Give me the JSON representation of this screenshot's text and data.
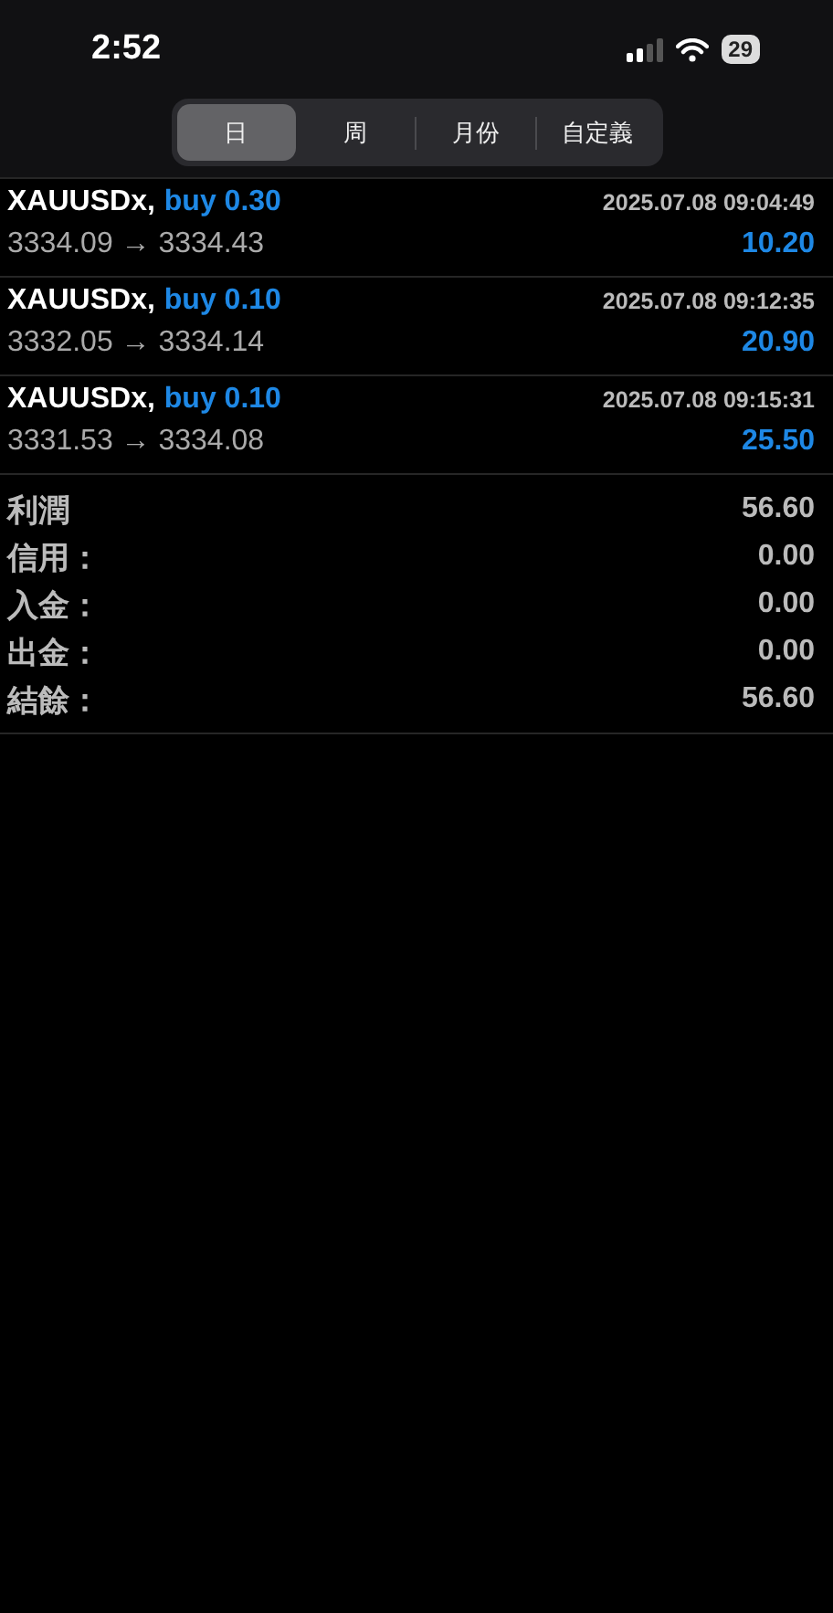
{
  "status_bar": {
    "time": "2:52",
    "battery": "29"
  },
  "tabs": [
    {
      "label": "日",
      "selected": true
    },
    {
      "label": "周",
      "selected": false
    },
    {
      "label": "月份",
      "selected": false
    },
    {
      "label": "自定義",
      "selected": false
    }
  ],
  "trades": [
    {
      "symbol": "XAUUSDx,",
      "side": "buy 0.30",
      "time": "2025.07.08 09:04:49",
      "prices": "3334.09 → 3334.43",
      "profit": "10.20"
    },
    {
      "symbol": "XAUUSDx,",
      "side": "buy 0.10",
      "time": "2025.07.08 09:12:35",
      "prices": "3332.05 → 3334.14",
      "profit": "20.90"
    },
    {
      "symbol": "XAUUSDx,",
      "side": "buy 0.10",
      "time": "2025.07.08 09:15:31",
      "prices": "3331.53 → 3334.08",
      "profit": "25.50"
    }
  ],
  "summary": [
    {
      "label": "利潤",
      "value": "56.60"
    },
    {
      "label": "信用：",
      "value": "0.00"
    },
    {
      "label": "入金：",
      "value": "0.00"
    },
    {
      "label": "出金：",
      "value": "0.00"
    },
    {
      "label": "結餘：",
      "value": "56.60"
    }
  ]
}
